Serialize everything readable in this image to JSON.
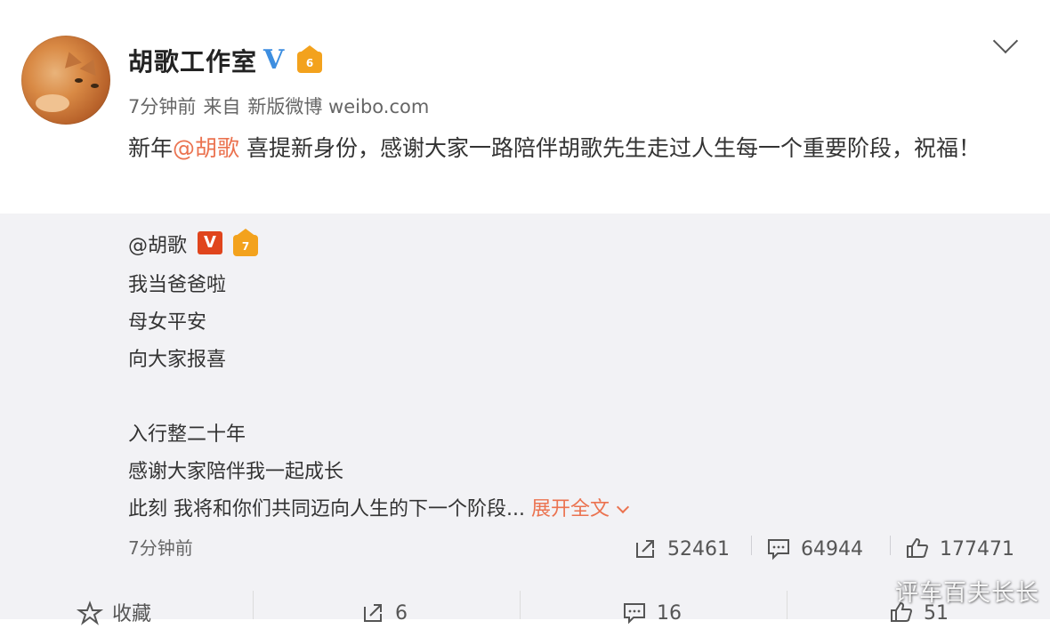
{
  "post": {
    "username": "胡歌工作室",
    "verified_badge": "V",
    "vip_level": "6",
    "meta": {
      "time": "7分钟前",
      "source_prefix": "来自",
      "source": "新版微博 weibo.com"
    },
    "text_prefix": "新年",
    "mention": "@胡歌",
    "text_body": " 喜提新身份，感谢大家一路陪伴胡歌先生走过人生每一个重要阶段，祝福！"
  },
  "repost": {
    "author": "@胡歌",
    "verified_badge": "V",
    "vip_level": "7",
    "lines": [
      "我当爸爸啦",
      "母女平安",
      "向大家报喜",
      "入行整二十年",
      "感谢大家陪伴我一起成长",
      "此刻 我将和你们共同迈向人生的下一个阶段..."
    ],
    "expand_label": "展开全文",
    "time": "7分钟前",
    "stats": {
      "reposts": "52461",
      "comments": "64944",
      "likes": "177471"
    }
  },
  "footer": {
    "favorite_label": "收藏",
    "reposts": "6",
    "comments": "16",
    "likes": "51"
  },
  "watermark": "评车百夫长长",
  "colors": {
    "accent": "#eb7350",
    "verified_blue": "#3d8ee0",
    "vip_orange": "#f3a21d",
    "quote_bg": "#f2f2f5"
  },
  "icons": [
    "chevron-down-icon",
    "share-icon",
    "comment-icon",
    "like-icon",
    "star-icon"
  ]
}
